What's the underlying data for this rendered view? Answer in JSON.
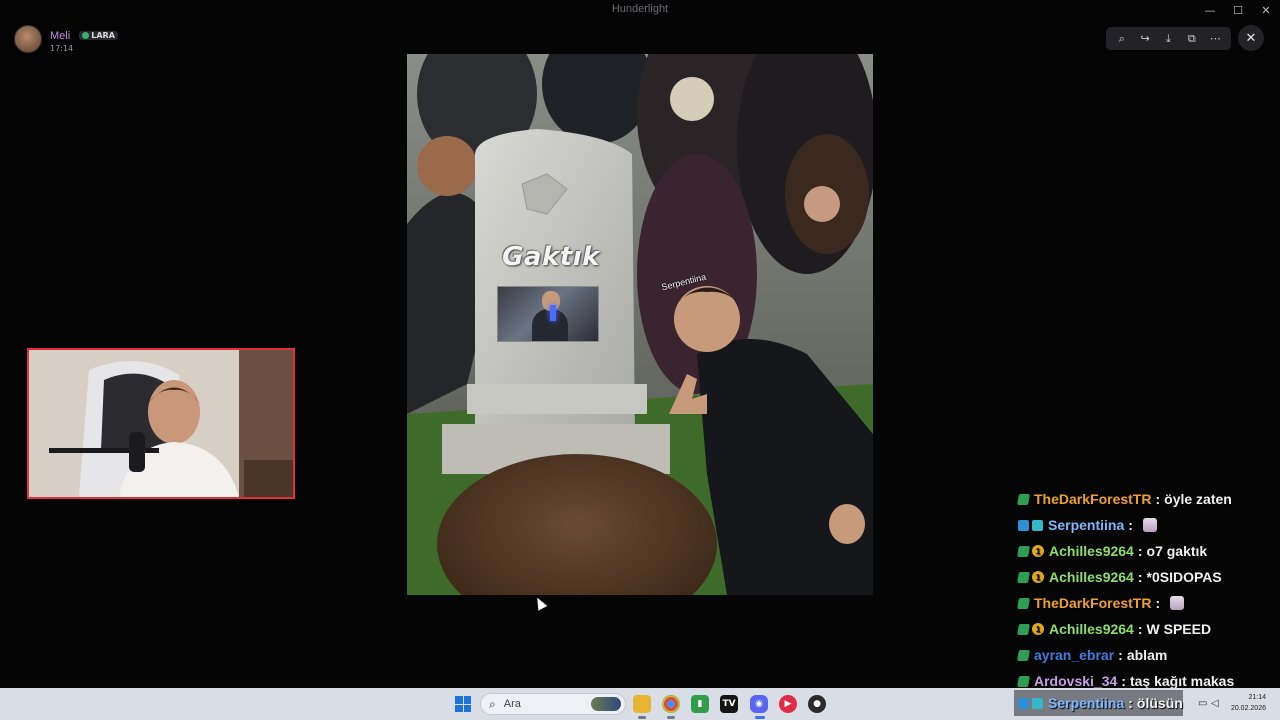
{
  "window": {
    "title": "Hunderlight"
  },
  "user": {
    "name": "Meli",
    "tag": "LARA",
    "time": "17:14"
  },
  "viewer": {
    "tools": [
      "zoom-in-icon",
      "share-icon",
      "download-icon",
      "open-external-icon",
      "more-icon"
    ],
    "close": "close-icon"
  },
  "image": {
    "tombstone_text": "Gaktık",
    "photo_label": "Serpentiina"
  },
  "chat": {
    "messages": [
      {
        "user": "TheDarkForestTR",
        "color": "#f0a030",
        "badges": [
          "sub"
        ],
        "text": "öyle zaten",
        "emote": false
      },
      {
        "user": "Serpentiina",
        "color": "#7fb7ff",
        "badges": [
          "mod",
          "vip"
        ],
        "text": "",
        "emote": true
      },
      {
        "user": "Achilles9264",
        "color": "#8ee06a",
        "badges": [
          "sub",
          "num"
        ],
        "text": "o7 gaktık",
        "emote": false
      },
      {
        "user": "Achilles9264",
        "color": "#8ee06a",
        "badges": [
          "sub",
          "num"
        ],
        "text": "*0SIDOPAS",
        "emote": false
      },
      {
        "user": "TheDarkForestTR",
        "color": "#f0a030",
        "badges": [
          "sub"
        ],
        "text": "",
        "emote": true
      },
      {
        "user": "Achilles9264",
        "color": "#8ee06a",
        "badges": [
          "sub",
          "num"
        ],
        "text": "W SPEED",
        "emote": false
      },
      {
        "user": "ayran_ebrar",
        "color": "#3f7fe0",
        "badges": [
          "sub"
        ],
        "text": "ablam",
        "emote": false
      },
      {
        "user": "Ardovski_34",
        "color": "#c79ee8",
        "badges": [
          "sub"
        ],
        "text": "taş kağıt makas",
        "emote": false
      }
    ],
    "last": {
      "user": "Serpentiina",
      "color": "#7fb7ff",
      "text": "ölüsün"
    }
  },
  "taskbar": {
    "search_placeholder": "Ara",
    "time": "21:14",
    "date": "20.02.2026"
  }
}
